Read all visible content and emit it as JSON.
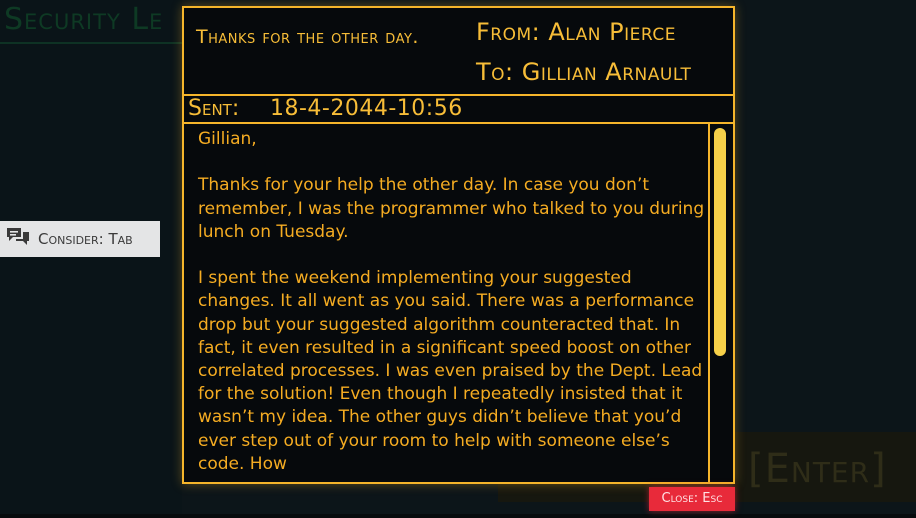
{
  "background": {
    "title": "Security Le",
    "enter_hint": "[Enter]"
  },
  "consider_prompt": {
    "icon": "chat-bubbles-icon",
    "label": "Consider: Tab"
  },
  "email": {
    "subject": "Thanks for the other day.",
    "from": "From:  Alan Pierce",
    "to": "To: Gillian Arnault",
    "sent_label": "Sent:",
    "sent_value": "18-4-2044-10:56",
    "greeting": "Gillian,",
    "paragraph_1": "Thanks for your help the other day. In case you don’t remember, I was the programmer who talked to you during lunch on Tuesday.",
    "paragraph_2": "I spent the weekend implementing your suggested changes. It all went as you said. There was a performance drop but your suggested algorithm counteracted that. In fact, it even resulted in a significant speed boost on other correlated processes. I was even praised by the Dept. Lead for the solution! Even though I repeatedly insisted that it wasn’t my idea. The other guys didn’t believe that you’d ever step out of your room to help with someone else’s code. How"
  },
  "close_button": {
    "label": "Close: Esc"
  },
  "colors": {
    "accent": "#f5b52b",
    "body_text": "#f5ac22",
    "scroll_thumb": "#f6d049",
    "close_button": "#e82a3a",
    "background": "#0c1519"
  }
}
